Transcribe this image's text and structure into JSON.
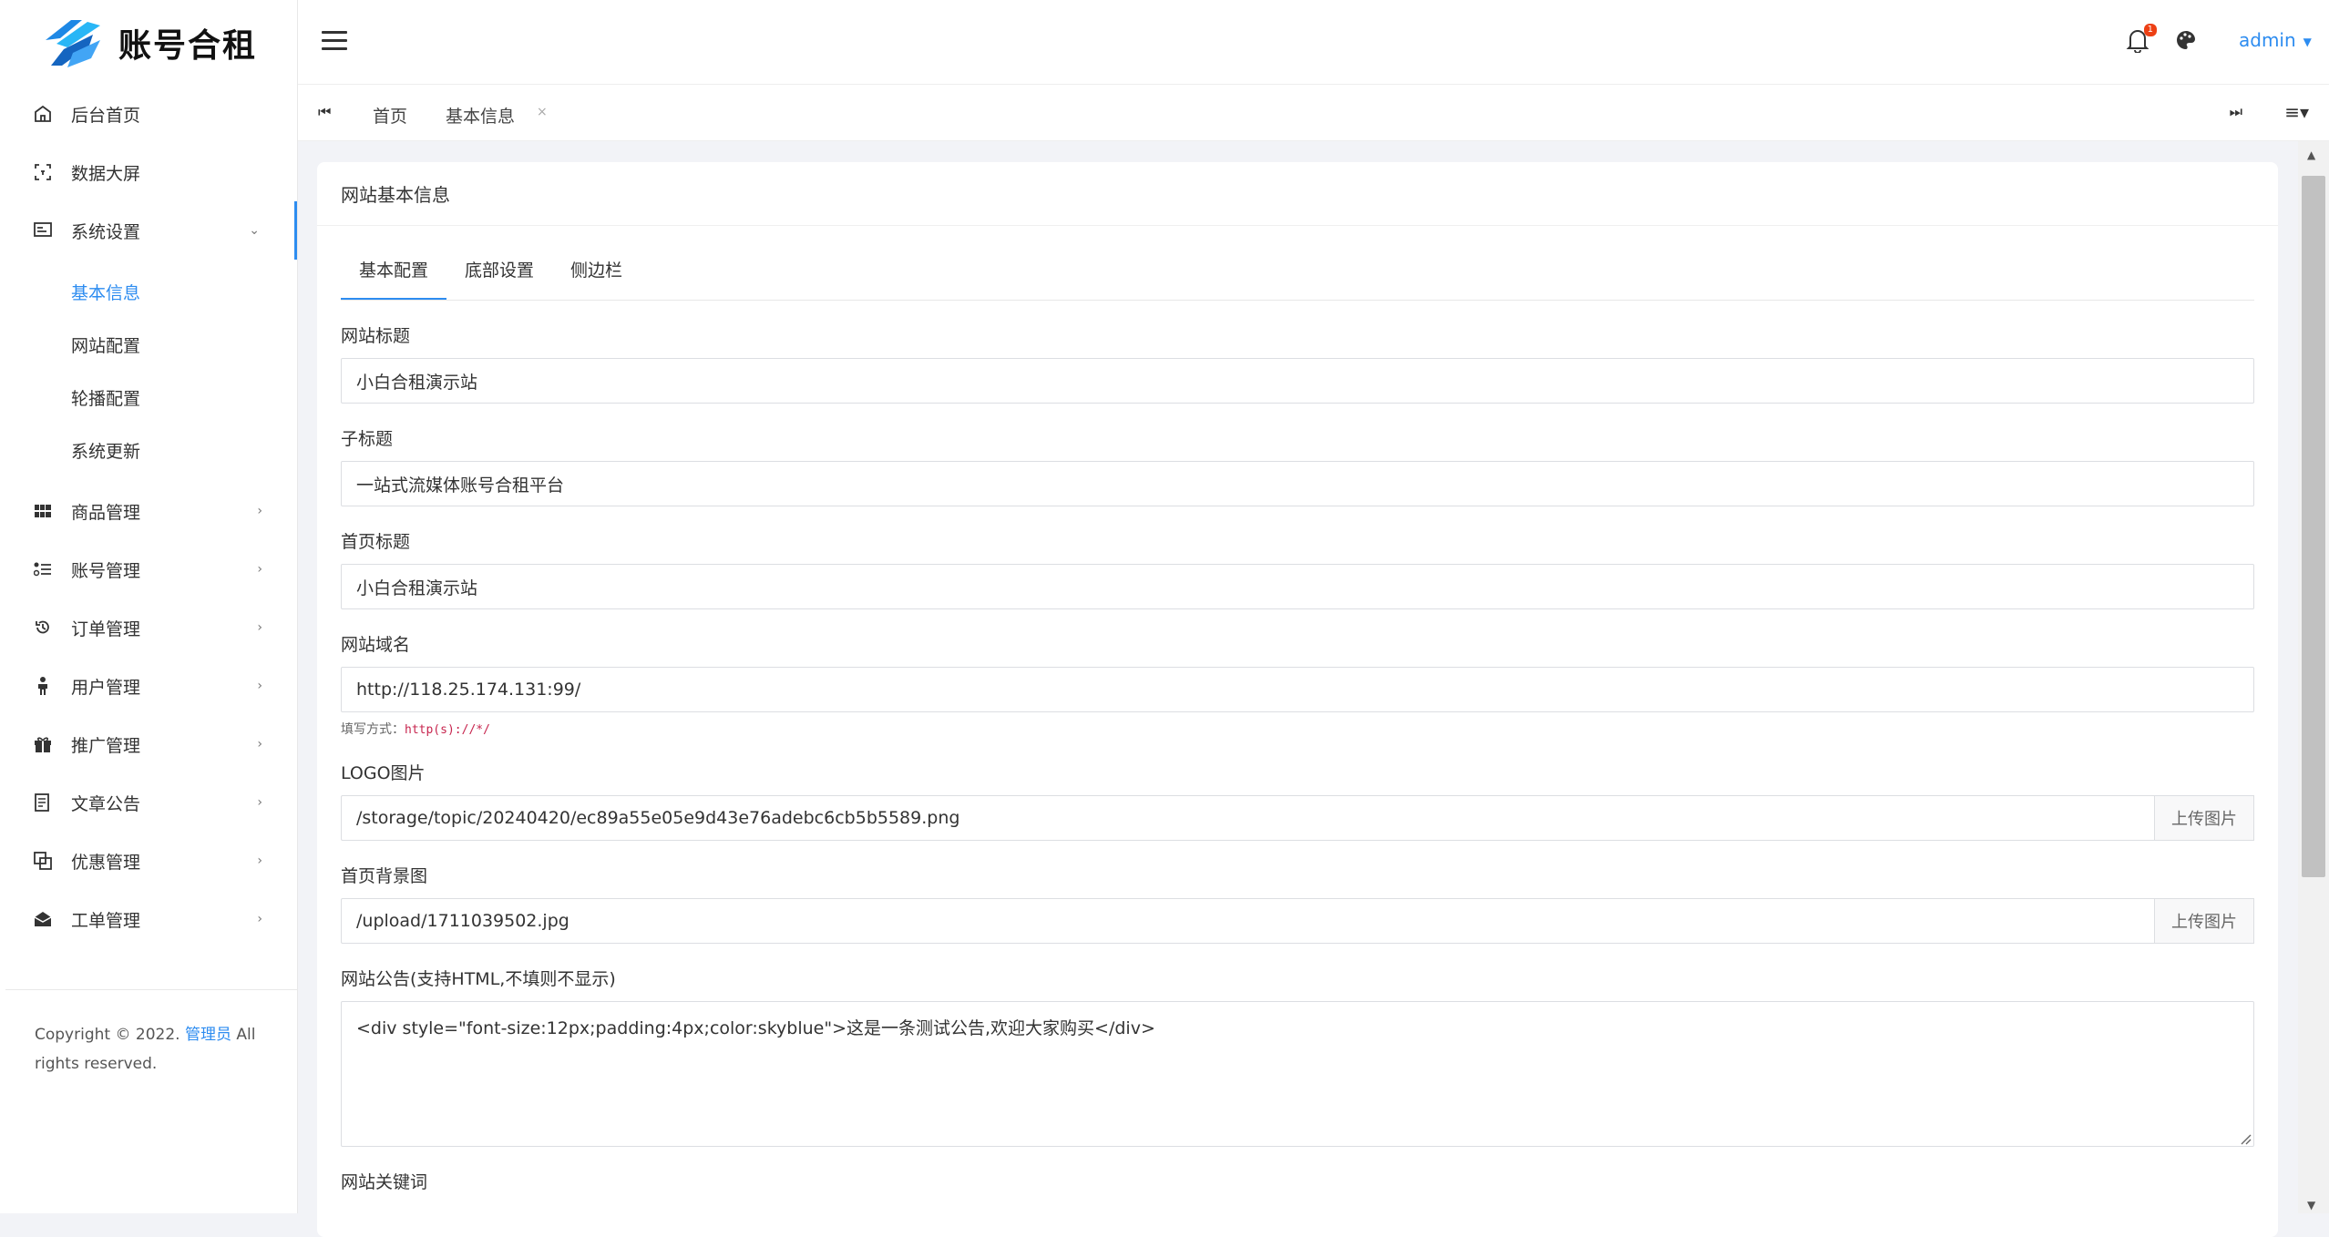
{
  "brand": {
    "title": "账号合租"
  },
  "sidebar": {
    "items": [
      {
        "label": "后台首页",
        "icon": "home-icon"
      },
      {
        "label": "数据大屏",
        "icon": "fullscreen-icon"
      },
      {
        "label": "系统设置",
        "icon": "settings-icon",
        "expanded": true,
        "children": [
          "基本信息",
          "网站配置",
          "轮播配置",
          "系统更新"
        ],
        "current": "基本信息"
      },
      {
        "label": "商品管理",
        "icon": "grid-icon"
      },
      {
        "label": "账号管理",
        "icon": "list-icon"
      },
      {
        "label": "订单管理",
        "icon": "history-icon"
      },
      {
        "label": "用户管理",
        "icon": "user-icon"
      },
      {
        "label": "推广管理",
        "icon": "gift-icon"
      },
      {
        "label": "文章公告",
        "icon": "article-icon"
      },
      {
        "label": "优惠管理",
        "icon": "copy-icon"
      },
      {
        "label": "工单管理",
        "icon": "mail-icon"
      }
    ],
    "copyright_prefix": "Copyright © 2022.",
    "copyright_link": "管理员",
    "copyright_suffix": "All rights reserved."
  },
  "header": {
    "user": "admin",
    "notification_count": "1"
  },
  "tabsbar": {
    "tabs": [
      "首页",
      "基本信息"
    ],
    "close": "×"
  },
  "card": {
    "title": "网站基本信息",
    "tabs": [
      "基本配置",
      "底部设置",
      "侧边栏"
    ],
    "fields": {
      "site_title_label": "网站标题",
      "site_title_value": "小白合租演示站",
      "subtitle_label": "子标题",
      "subtitle_value": "一站式流媒体账号合租平台",
      "home_title_label": "首页标题",
      "home_title_value": "小白合租演示站",
      "domain_label": "网站域名",
      "domain_value": "http://118.25.174.131:99/",
      "domain_help_prefix": "填写方式：",
      "domain_help_code": "http(s)://*/",
      "logo_label": "LOGO图片",
      "logo_value": "/storage/topic/20240420/ec89a55e05e9d43e76adebc6cb5b5589.png",
      "upload_label": "上传图片",
      "bg_label": "首页背景图",
      "bg_value": "/upload/1711039502.jpg",
      "notice_label": "网站公告(支持HTML,不填则不显示)",
      "notice_value": "<div style=\"font-size:12px;padding:4px;color:skyblue\">这是一条测试公告,欢迎大家购买</div>",
      "keywords_label": "网站关键词"
    }
  },
  "colors": {
    "accent": "#2d8cf0",
    "badge": "#ed4014"
  }
}
